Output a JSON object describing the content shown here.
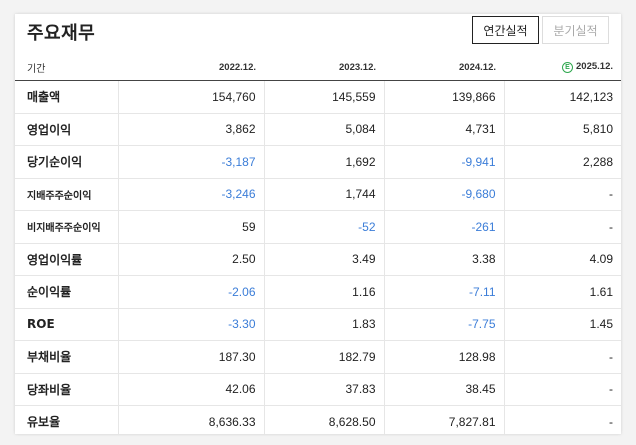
{
  "header": {
    "title": "주요재무",
    "tab_annual": "연간실적",
    "tab_quarter": "분기실적"
  },
  "columns": {
    "label": "기간",
    "periods": [
      "2022.12.",
      "2023.12.",
      "2024.12.",
      "2025.12."
    ],
    "estimate_marker": "E"
  },
  "rows": [
    {
      "label": "매출액",
      "values": [
        "154,760",
        "145,559",
        "139,866",
        "142,123"
      ]
    },
    {
      "label": "영업이익",
      "values": [
        "3,862",
        "5,084",
        "4,731",
        "5,810"
      ]
    },
    {
      "label": "당기순이익",
      "values": [
        "-3,187",
        "1,692",
        "-9,941",
        "2,288"
      ]
    },
    {
      "label": "지배주주순이익",
      "values": [
        "-3,246",
        "1,744",
        "-9,680",
        "-"
      ]
    },
    {
      "label": "비지배주주순이익",
      "values": [
        "59",
        "-52",
        "-261",
        "-"
      ]
    },
    {
      "label": "영업이익률",
      "values": [
        "2.50",
        "3.49",
        "3.38",
        "4.09"
      ]
    },
    {
      "label": "순이익률",
      "values": [
        "-2.06",
        "1.16",
        "-7.11",
        "1.61"
      ]
    },
    {
      "label": "ROE",
      "values": [
        "-3.30",
        "1.83",
        "-7.75",
        "1.45"
      ]
    },
    {
      "label": "부채비율",
      "values": [
        "187.30",
        "182.79",
        "128.98",
        "-"
      ]
    },
    {
      "label": "당좌비율",
      "values": [
        "42.06",
        "37.83",
        "38.45",
        "-"
      ]
    },
    {
      "label": "유보율",
      "values": [
        "8,636.33",
        "8,628.50",
        "7,827.81",
        "-"
      ]
    }
  ],
  "colors": {
    "negative": "#3b7dd8",
    "estimate_icon": "#2fa84f"
  }
}
